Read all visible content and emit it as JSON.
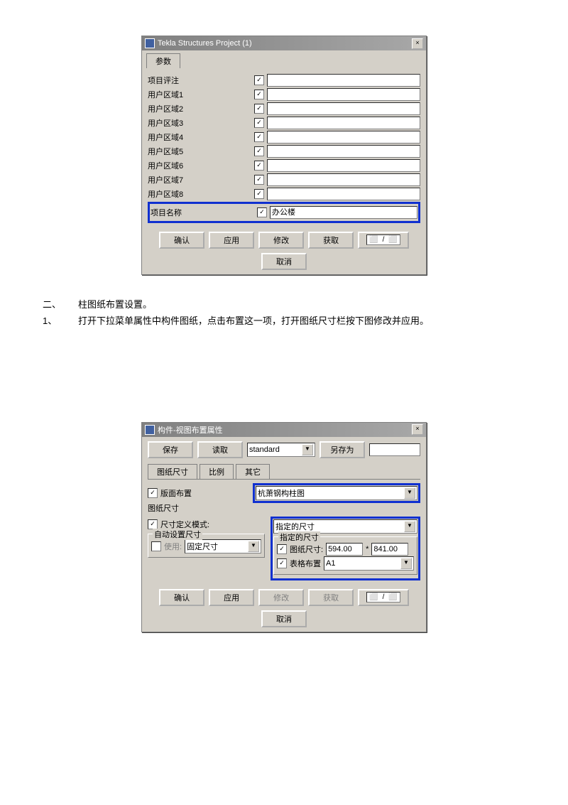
{
  "dlg1": {
    "title": "Tekla Structures  Project (1)",
    "tab": "参数",
    "rows": [
      {
        "label": "项目评注",
        "value": ""
      },
      {
        "label": "用户区域1",
        "value": ""
      },
      {
        "label": "用户区域2",
        "value": ""
      },
      {
        "label": "用户区域3",
        "value": ""
      },
      {
        "label": "用户区域4",
        "value": ""
      },
      {
        "label": "用户区域5",
        "value": ""
      },
      {
        "label": "用户区域6",
        "value": ""
      },
      {
        "label": "用户区域7",
        "value": ""
      },
      {
        "label": "用户区域8",
        "value": ""
      }
    ],
    "highlight": {
      "label": "项目名称",
      "value": "办公楼"
    },
    "buttons": {
      "ok": "确认",
      "apply": "应用",
      "modify": "修改",
      "get": "获取",
      "cancel": "取消"
    }
  },
  "text": {
    "heading": "柱图纸布置设置。",
    "heading_num": "二、",
    "line1_num": "1、",
    "line1": "打开下拉菜单属性中构件图纸，点击布置这一项，打开图纸尺寸栏按下图修改并应用。"
  },
  "dlg2": {
    "title": "构件-视图布置属性",
    "top": {
      "save": "保存",
      "load": "读取",
      "preset": "standard",
      "saveas": "另存为"
    },
    "tabs": {
      "t1": "图纸尺寸",
      "t2": "比例",
      "t3": "其它"
    },
    "layout": {
      "label": "版面布置",
      "value": "杭萧钢构柱图"
    },
    "section": "图纸尺寸",
    "mode": {
      "label": "尺寸定义模式:",
      "value": "指定的尺寸"
    },
    "auto": {
      "group": "自动设置尺寸",
      "use": "使用:",
      "preset": "固定尺寸"
    },
    "spec": {
      "group": "指定的尺寸",
      "sizelbl": "图纸尺寸:",
      "w": "594.00",
      "sep": "*",
      "h": "841.00",
      "tbllbl": "表格布置",
      "tbl": "A1"
    },
    "buttons": {
      "ok": "确认",
      "apply": "应用",
      "modify": "修改",
      "get": "获取",
      "cancel": "取消"
    }
  }
}
